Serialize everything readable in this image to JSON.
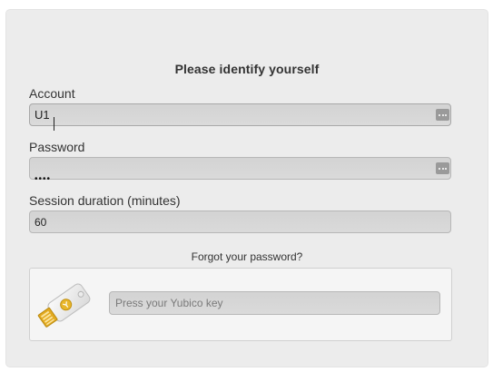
{
  "login": {
    "title": "Please identify yourself",
    "account": {
      "label": "Account",
      "value": "U1",
      "menu_icon": "more-options-icon"
    },
    "password": {
      "label": "Password",
      "value": "••••",
      "menu_icon": "more-options-icon"
    },
    "session": {
      "label": "Session duration (minutes)",
      "value": "60"
    },
    "forgot_link": "Forgot your password?",
    "yubikey": {
      "icon": "yubikey-icon",
      "placeholder": "Press your Yubico key",
      "value": ""
    }
  },
  "colors": {
    "panel_bg": "#ececec",
    "field_bg": "#d6d6d6",
    "text": "#333333",
    "key_gold": "#e8b62a"
  }
}
